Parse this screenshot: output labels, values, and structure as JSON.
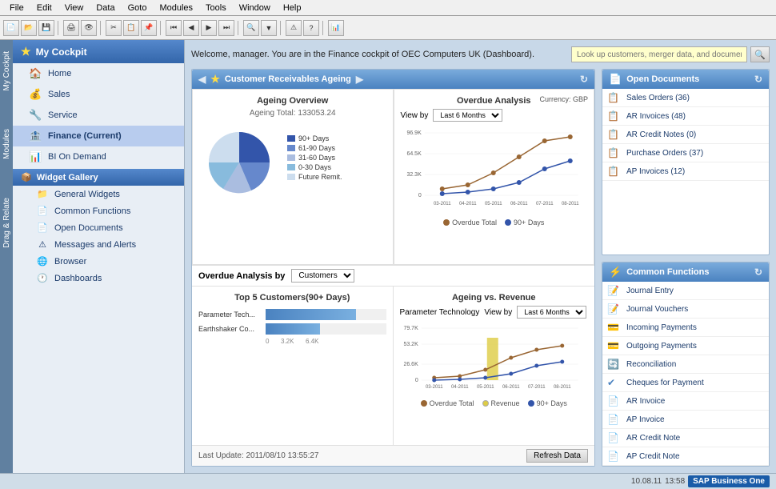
{
  "menubar": {
    "items": [
      "File",
      "Edit",
      "View",
      "Data",
      "Goto",
      "Modules",
      "Tools",
      "Window",
      "Help"
    ]
  },
  "welcome": {
    "text": "Welcome, manager. You are in the Finance cockpit of OEC Computers UK (Dashboard).",
    "search_placeholder": "Look up customers, merger data, and documents"
  },
  "sidebar": {
    "header": "My Cockpit",
    "nav_items": [
      {
        "label": "Home",
        "icon": "🏠"
      },
      {
        "label": "Sales",
        "icon": "💰"
      },
      {
        "label": "Service",
        "icon": "🔧"
      },
      {
        "label": "Finance (Current)",
        "icon": "🏦"
      },
      {
        "label": "BI On Demand",
        "icon": "📊"
      }
    ],
    "widget_gallery": "Widget Gallery",
    "sub_items": [
      {
        "label": "General Widgets",
        "icon": "📁"
      },
      {
        "label": "Common Functions",
        "icon": "📄"
      },
      {
        "label": "Open Documents",
        "icon": "📄"
      },
      {
        "label": "Messages and Alerts",
        "icon": "⚠"
      },
      {
        "label": "Browser",
        "icon": "🌐"
      },
      {
        "label": "Dashboards",
        "icon": "🕐"
      }
    ]
  },
  "main_panel": {
    "title": "Customer Receivables Ageing",
    "currency": "Currency: GBP",
    "ageing_overview": {
      "title": "Ageing Overview",
      "subtitle": "Ageing Total: 133053.24",
      "legend": [
        {
          "label": "90+ Days",
          "color": "#3355aa"
        },
        {
          "label": "61-90 Days",
          "color": "#6688cc"
        },
        {
          "label": "31-60 Days",
          "color": "#aabde0"
        },
        {
          "label": "0-30 Days",
          "color": "#88bbdd"
        },
        {
          "label": "Future Remit.",
          "color": "#ccddee"
        }
      ]
    },
    "overdue_analysis": {
      "title": "Overdue Analysis",
      "view_by_label": "View by",
      "period": "Last 6 Months",
      "x_labels": [
        "03-2011",
        "04-2011",
        "05-2011",
        "06-2011",
        "07-2011",
        "08-2011"
      ],
      "legend": [
        {
          "label": "Overdue Total",
          "color": "#996633"
        },
        {
          "label": "90+ Days",
          "color": "#3355aa"
        }
      ]
    },
    "overdue_by": {
      "title": "Overdue Analysis by",
      "category": "Customers"
    },
    "top5": {
      "title": "Top 5 Customers(90+ Days)",
      "items": [
        {
          "label": "Parameter Tech...",
          "value": 75
        },
        {
          "label": "Earthshaker Co...",
          "value": 45
        }
      ],
      "axis": [
        "0",
        "3.2K",
        "6.4K"
      ]
    },
    "ageing_vs_revenue": {
      "title": "Ageing vs. Revenue",
      "company": "Parameter Technology",
      "view_by": "Last 6 Months",
      "y_labels": [
        "79.7K",
        "53.2K",
        "26.6K",
        "0"
      ],
      "x_labels": [
        "03-2011",
        "04-2011",
        "05-2011",
        "06-2011",
        "07-2011",
        "08-2011"
      ],
      "legend": [
        {
          "label": "Overdue Total",
          "color": "#996633"
        },
        {
          "label": "Revenue",
          "color": "#ddcc44"
        },
        {
          "label": "90+ Days",
          "color": "#3355aa"
        }
      ]
    },
    "footer": {
      "last_update": "Last Update: 2011/08/10 13:55:27",
      "refresh_btn": "Refresh Data"
    }
  },
  "open_documents": {
    "title": "Open Documents",
    "items": [
      {
        "label": "Sales Orders (36)"
      },
      {
        "label": "AR Invoices (48)"
      },
      {
        "label": "AR Credit Notes (0)"
      },
      {
        "label": "Purchase Orders (37)"
      },
      {
        "label": "AP Invoices (12)"
      }
    ]
  },
  "common_functions": {
    "title": "Common Functions",
    "items": [
      {
        "label": "Journal Entry"
      },
      {
        "label": "Journal Vouchers"
      },
      {
        "label": "Incoming Payments"
      },
      {
        "label": "Outgoing Payments"
      },
      {
        "label": "Reconciliation"
      },
      {
        "label": "Cheques for Payment"
      },
      {
        "label": "AR Invoice"
      },
      {
        "label": "AP Invoice"
      },
      {
        "label": "AR Credit Note"
      },
      {
        "label": "AP Credit Note"
      }
    ]
  },
  "statusbar": {
    "date": "10.08.11",
    "time": "13:58",
    "sap": "SAP Business One"
  },
  "side_tabs": [
    "My Cockpit",
    "Modules",
    "Drag & Relate"
  ]
}
